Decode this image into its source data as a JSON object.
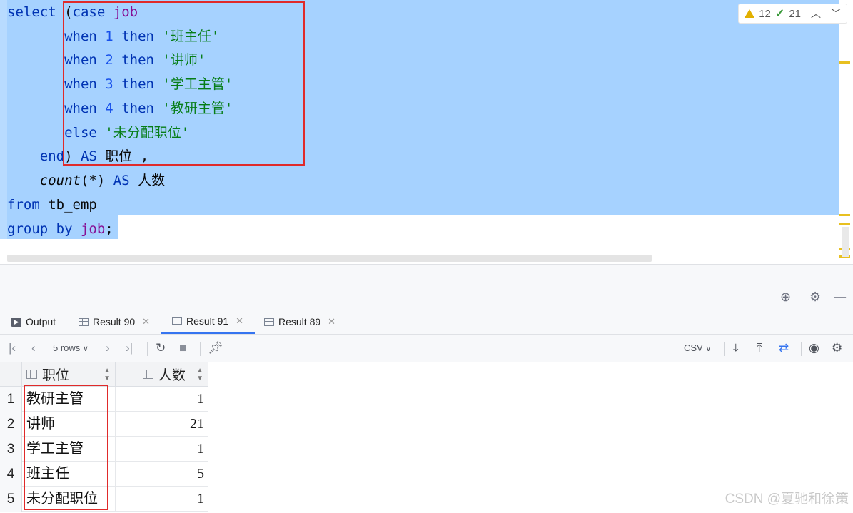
{
  "editor": {
    "lines": [
      [
        {
          "t": "select",
          "c": "kw"
        },
        {
          "t": " (",
          "c": "plain"
        },
        {
          "t": "case",
          "c": "kw"
        },
        {
          "t": " ",
          "c": "plain"
        },
        {
          "t": "job",
          "c": "col"
        }
      ],
      [
        {
          "t": "       when",
          "c": "kw"
        },
        {
          "t": " ",
          "c": "plain"
        },
        {
          "t": "1",
          "c": "num"
        },
        {
          "t": " then ",
          "c": "kw"
        },
        {
          "t": "'班主任'",
          "c": "str"
        }
      ],
      [
        {
          "t": "       when",
          "c": "kw"
        },
        {
          "t": " ",
          "c": "plain"
        },
        {
          "t": "2",
          "c": "num"
        },
        {
          "t": " then ",
          "c": "kw"
        },
        {
          "t": "'讲师'",
          "c": "str"
        }
      ],
      [
        {
          "t": "       when",
          "c": "kw"
        },
        {
          "t": " ",
          "c": "plain"
        },
        {
          "t": "3",
          "c": "num"
        },
        {
          "t": " then ",
          "c": "kw"
        },
        {
          "t": "'学工主管'",
          "c": "str"
        }
      ],
      [
        {
          "t": "       when",
          "c": "kw"
        },
        {
          "t": " ",
          "c": "plain"
        },
        {
          "t": "4",
          "c": "num"
        },
        {
          "t": " then ",
          "c": "kw"
        },
        {
          "t": "'教研主管'",
          "c": "str"
        }
      ],
      [
        {
          "t": "       else",
          "c": "kw"
        },
        {
          "t": " ",
          "c": "plain"
        },
        {
          "t": "'未分配职位'",
          "c": "str"
        }
      ],
      [
        {
          "t": "    end",
          "c": "kw"
        },
        {
          "t": ") ",
          "c": "plain"
        },
        {
          "t": "AS",
          "c": "kw"
        },
        {
          "t": " 职位 ,",
          "c": "plain"
        }
      ],
      [
        {
          "t": "    ",
          "c": "plain"
        },
        {
          "t": "count",
          "c": "fn"
        },
        {
          "t": "(*) ",
          "c": "plain"
        },
        {
          "t": "AS",
          "c": "kw"
        },
        {
          "t": " 人数",
          "c": "plain"
        }
      ],
      [
        {
          "t": "from",
          "c": "kw"
        },
        {
          "t": " tb_emp",
          "c": "plain"
        }
      ],
      [
        {
          "t": "group by",
          "c": "kw"
        },
        {
          "t": " ",
          "c": "plain"
        },
        {
          "t": "job",
          "c": "col"
        },
        {
          "t": ";",
          "c": "plain"
        }
      ]
    ],
    "warnings": "12",
    "typos": "21"
  },
  "tabs": [
    {
      "label": "Output",
      "icon": "output-icon",
      "active": false
    },
    {
      "label": "Result 90",
      "icon": "table-icon",
      "active": false
    },
    {
      "label": "Result 91",
      "icon": "table-icon",
      "active": true
    },
    {
      "label": "Result 89",
      "icon": "table-icon",
      "active": false
    }
  ],
  "toolbar": {
    "rows_label": "5 rows",
    "export_format": "CSV"
  },
  "table": {
    "columns": [
      "职位",
      "人数"
    ],
    "rows": [
      {
        "n": "1",
        "job": "教研主管",
        "count": "1"
      },
      {
        "n": "2",
        "job": "讲师",
        "count": "21"
      },
      {
        "n": "3",
        "job": "学工主管",
        "count": "1"
      },
      {
        "n": "4",
        "job": "班主任",
        "count": "5"
      },
      {
        "n": "5",
        "job": "未分配职位",
        "count": "1"
      }
    ]
  },
  "watermark": "CSDN @夏驰和徐策",
  "colors": {
    "selection": "#a6d2ff",
    "highlight_box": "#e02a2a",
    "keyword": "#0033b3",
    "string": "#067d17",
    "column": "#871094",
    "active_tab": "#3574f0"
  }
}
